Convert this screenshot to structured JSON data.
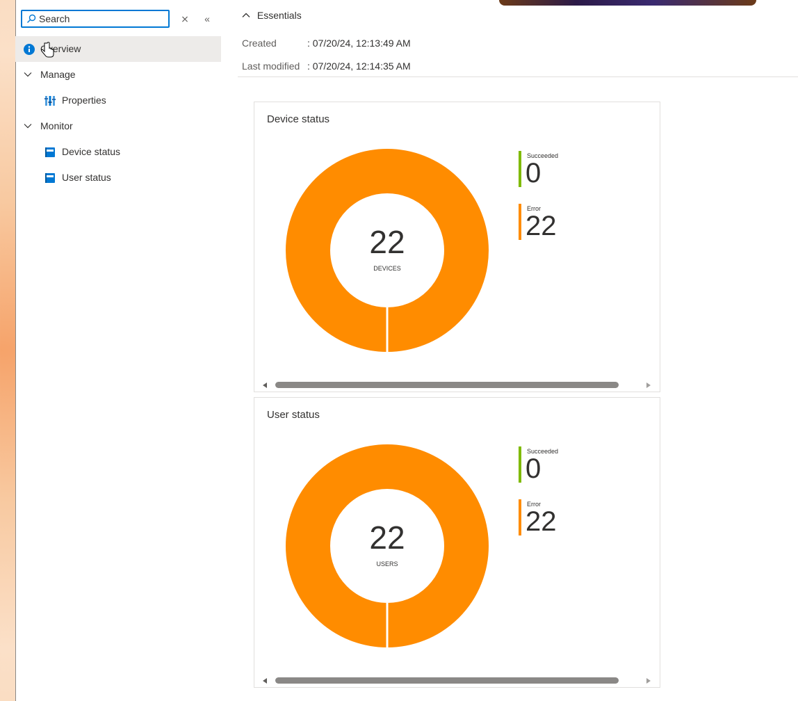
{
  "sidebar": {
    "search": {
      "placeholder": "Search"
    },
    "clear_label": "⨯",
    "collapse_label": "«",
    "items": [
      {
        "label": "Overview",
        "icon": "info-icon",
        "active": true
      },
      {
        "label": "Manage",
        "icon": "chevron-down-icon",
        "group": true
      },
      {
        "label": "Properties",
        "icon": "properties-icon"
      },
      {
        "label": "Monitor",
        "icon": "chevron-down-icon",
        "group": true
      },
      {
        "label": "Device status",
        "icon": "report-icon"
      },
      {
        "label": "User status",
        "icon": "report-icon"
      }
    ]
  },
  "essentials": {
    "header": "Essentials",
    "created_label": "Created",
    "created_value": ": 07/20/24, 12:13:49 AM",
    "modified_label": "Last modified",
    "modified_value": ": 07/20/24, 12:14:35 AM"
  },
  "colors": {
    "succeeded": "#7fba00",
    "error": "#ff8c00",
    "accent": "#0078d4"
  },
  "cards": [
    {
      "title": "Device status",
      "total": "22",
      "unit": "DEVICES",
      "legend": [
        {
          "name": "Succeeded",
          "value": "0"
        },
        {
          "name": "Error",
          "value": "22"
        }
      ]
    },
    {
      "title": "User status",
      "total": "22",
      "unit": "USERS",
      "legend": [
        {
          "name": "Succeeded",
          "value": "0"
        },
        {
          "name": "Error",
          "value": "22"
        }
      ]
    }
  ]
}
